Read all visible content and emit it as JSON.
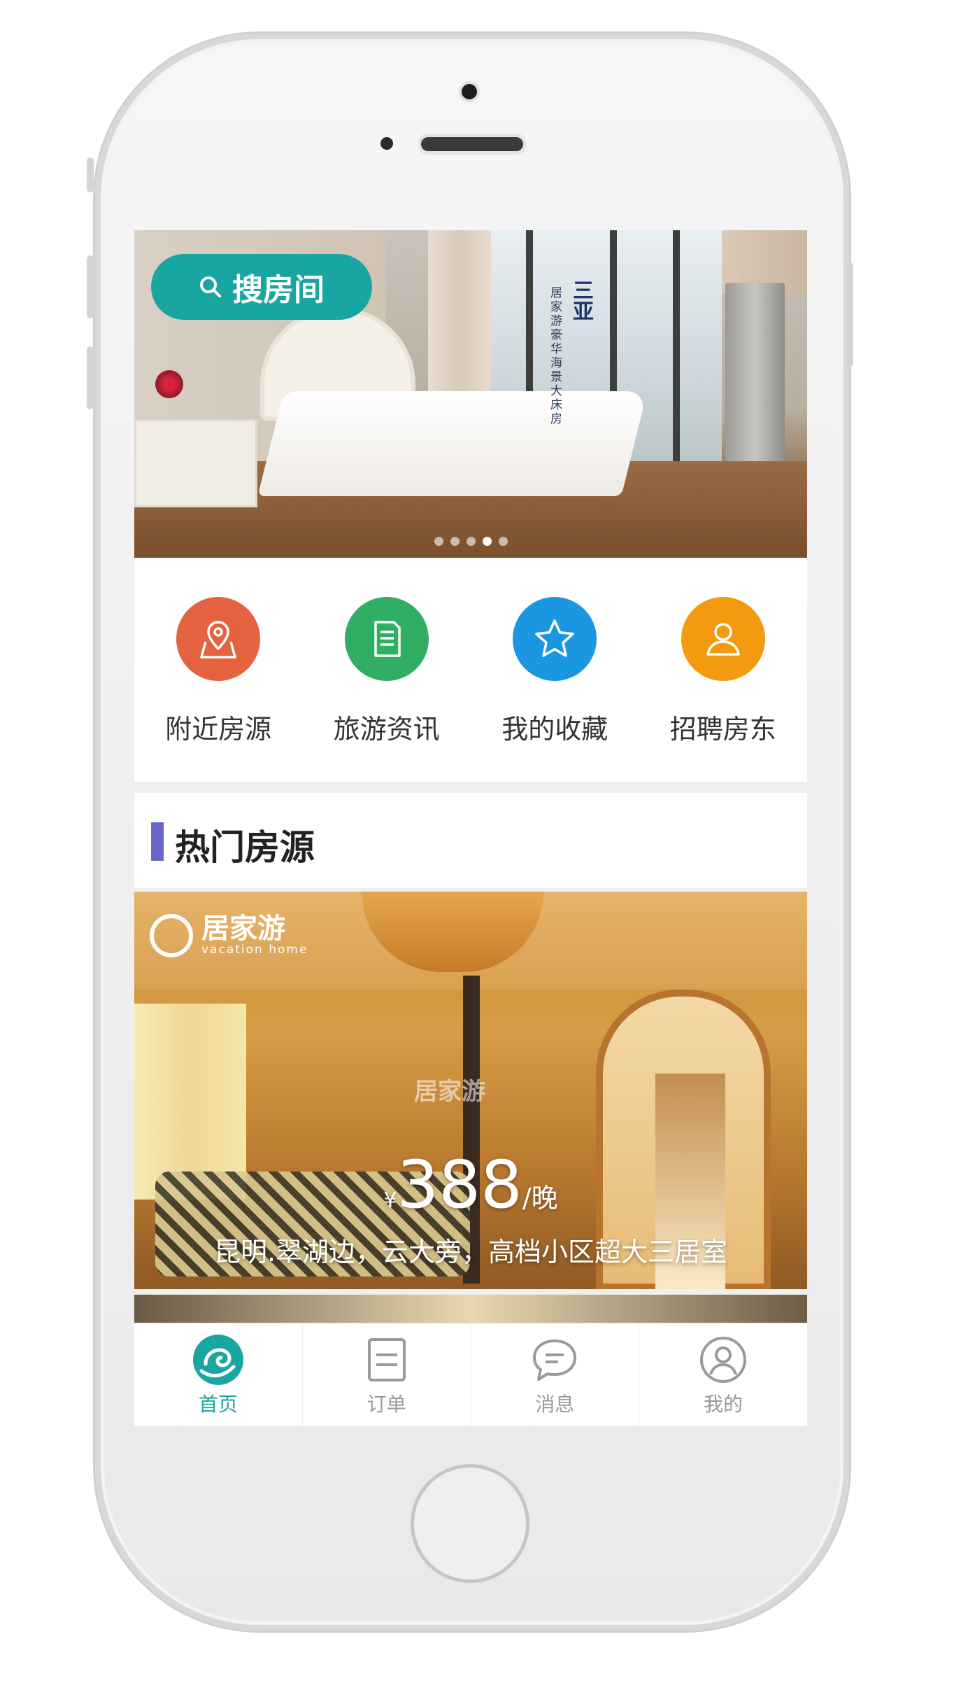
{
  "banner": {
    "search_label": "搜房间",
    "vertical_title": "三亚",
    "vertical_caption": "居家游豪华海景大床房",
    "dots_total": 5,
    "dots_active_index": 3
  },
  "quick_menu": [
    {
      "label": "附近房源",
      "icon": "location-map-icon",
      "color": "#e5623f"
    },
    {
      "label": "旅游资讯",
      "icon": "document-icon",
      "color": "#2fae64"
    },
    {
      "label": "我的收藏",
      "icon": "star-icon",
      "color": "#1b97e1"
    },
    {
      "label": "招聘房东",
      "icon": "user-icon",
      "color": "#f39a0f"
    }
  ],
  "section": {
    "title": "热门房源",
    "accent": "#6a66c8"
  },
  "listing": {
    "brand_cn": "居家游",
    "brand_en": "vacation home",
    "currency": "¥",
    "price": "388",
    "unit": "/晚",
    "title": "昆明.翠湖边，云大旁，高档小区超大三居室"
  },
  "tabbar": {
    "accent": "#1aa6a0",
    "items": [
      {
        "label": "首页",
        "icon": "home-logo-icon",
        "active": true
      },
      {
        "label": "订单",
        "icon": "order-icon",
        "active": false
      },
      {
        "label": "消息",
        "icon": "message-icon",
        "active": false
      },
      {
        "label": "我的",
        "icon": "profile-icon",
        "active": false
      }
    ]
  }
}
